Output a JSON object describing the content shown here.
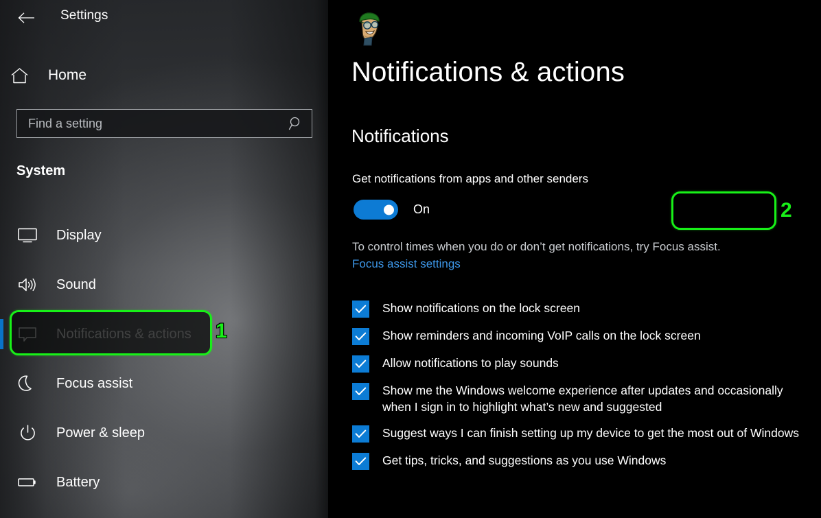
{
  "window": {
    "app_title": "Settings",
    "back_icon": "back-arrow-icon"
  },
  "sidebar": {
    "home": {
      "label": "Home",
      "icon": "home-icon"
    },
    "search": {
      "placeholder": "Find a setting",
      "value": "",
      "icon": "search-icon"
    },
    "section_header": "System",
    "items": [
      {
        "label": "Display",
        "icon": "monitor-icon",
        "selected": false
      },
      {
        "label": "Sound",
        "icon": "speaker-icon",
        "selected": false
      },
      {
        "label": "Notifications & actions",
        "icon": "speech-bubble-icon",
        "selected": true
      },
      {
        "label": "Focus assist",
        "icon": "moon-icon",
        "selected": false
      },
      {
        "label": "Power & sleep",
        "icon": "power-icon",
        "selected": false
      },
      {
        "label": "Battery",
        "icon": "battery-icon",
        "selected": false
      }
    ]
  },
  "content": {
    "avatar_icon": "user-avatar-icon",
    "page_title": "Notifications & actions",
    "section_title": "Notifications",
    "toggle": {
      "label": "Get notifications from apps and other senders",
      "state": "On",
      "checked": true
    },
    "help_text": "To control times when you do or don’t get notifications, try Focus assist.",
    "focus_link": "Focus assist settings",
    "checkboxes": [
      {
        "label": "Show notifications on the lock screen",
        "checked": true
      },
      {
        "label": "Show reminders and incoming VoIP calls on the lock screen",
        "checked": true
      },
      {
        "label": "Allow notifications to play sounds",
        "checked": true
      },
      {
        "label": "Show me the Windows welcome experience after updates and occasionally when I sign in to highlight what’s new and suggested",
        "checked": true
      },
      {
        "label": "Suggest ways I can finish setting up my device to get the most out of Windows",
        "checked": true
      },
      {
        "label": "Get tips, tricks, and suggestions as you use Windows",
        "checked": true
      }
    ]
  },
  "annotations": [
    {
      "number": "1",
      "target": "sidebar-item-notifications-actions"
    },
    {
      "number": "2",
      "target": "notifications-toggle"
    }
  ],
  "colors": {
    "accent_blue": "#0c7cd5",
    "link_blue": "#3d97e8",
    "selection_blue": "#0a73c8",
    "annotation_green": "#18f018",
    "panel_black": "#000000"
  }
}
